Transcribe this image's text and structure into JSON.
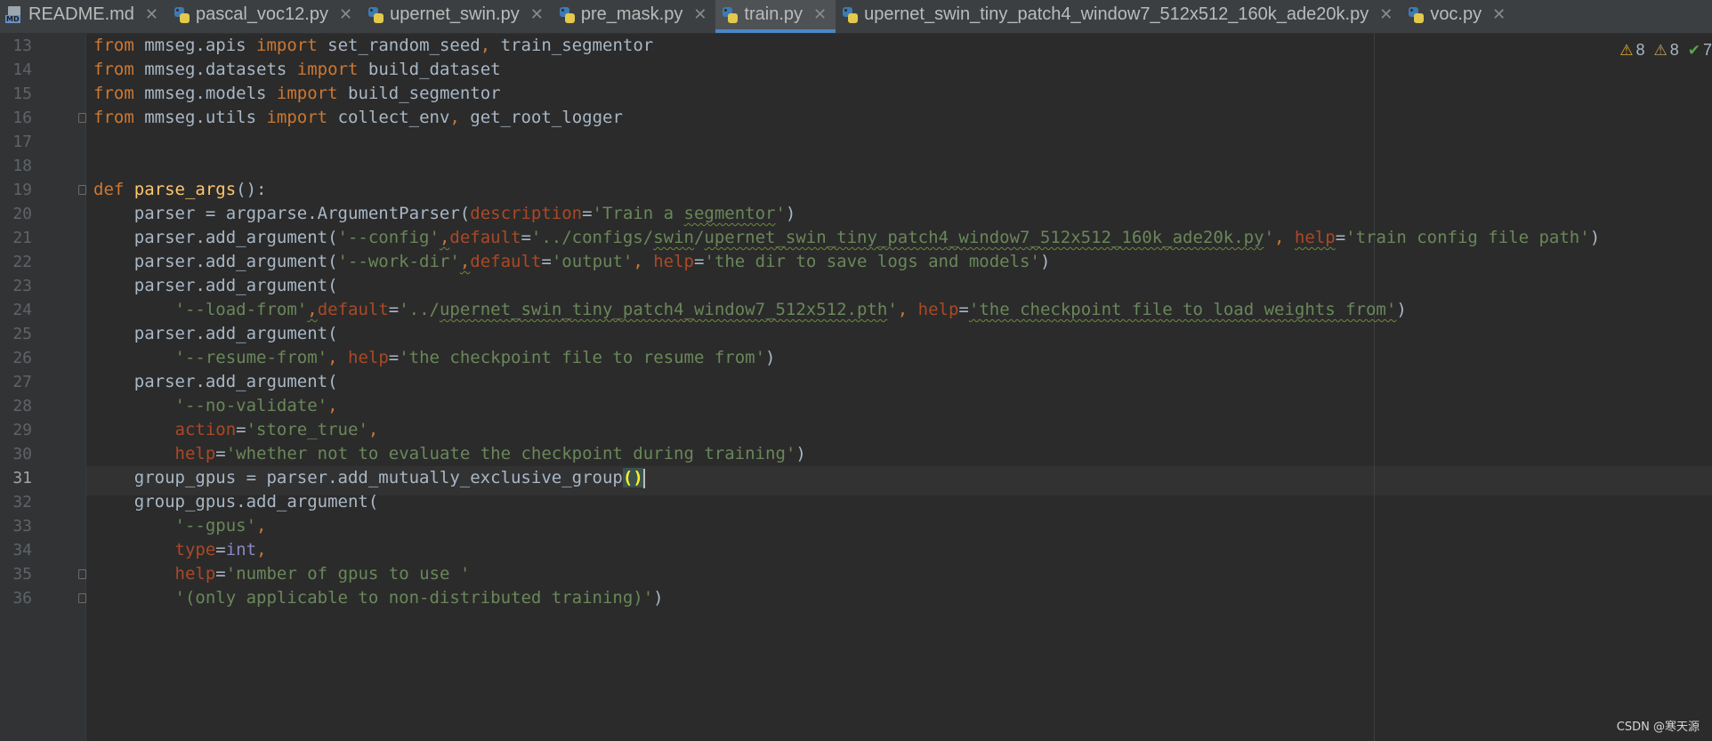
{
  "tabs": [
    {
      "label": "README.md",
      "icon": "markdown-file-icon",
      "icon_text": "MD",
      "active": false
    },
    {
      "label": "pascal_voc12.py",
      "icon": "python-file-icon",
      "active": false
    },
    {
      "label": "upernet_swin.py",
      "icon": "python-file-icon",
      "active": false
    },
    {
      "label": "pre_mask.py",
      "icon": "python-file-icon",
      "active": false
    },
    {
      "label": "train.py",
      "icon": "python-file-icon",
      "active": true
    },
    {
      "label": "upernet_swin_tiny_patch4_window7_512x512_160k_ade20k.py",
      "icon": "python-file-icon",
      "active": false
    },
    {
      "label": "voc.py",
      "icon": "python-file-icon",
      "active": false
    }
  ],
  "tab_close_glyph": "✕",
  "inspections": {
    "warnings": "8",
    "weak_warnings": "8",
    "passed": "7"
  },
  "editor": {
    "active_line": "31",
    "lines": [
      {
        "n": "13",
        "tokens": [
          {
            "t": "from",
            "c": "kw"
          },
          {
            "t": " mmseg.apis "
          },
          {
            "t": "import",
            "c": "kw"
          },
          {
            "t": " set_random_seed"
          },
          {
            "t": ",",
            "c": "kw"
          },
          {
            "t": " train_segmentor"
          }
        ]
      },
      {
        "n": "14",
        "tokens": [
          {
            "t": "from",
            "c": "kw"
          },
          {
            "t": " mmseg.datasets "
          },
          {
            "t": "import",
            "c": "kw"
          },
          {
            "t": " build_dataset"
          }
        ]
      },
      {
        "n": "15",
        "tokens": [
          {
            "t": "from",
            "c": "kw"
          },
          {
            "t": " mmseg.models "
          },
          {
            "t": "import",
            "c": "kw"
          },
          {
            "t": " build_segmentor"
          }
        ]
      },
      {
        "n": "16",
        "fold": true,
        "tokens": [
          {
            "t": "from",
            "c": "kw"
          },
          {
            "t": " mmseg.utils "
          },
          {
            "t": "import",
            "c": "kw"
          },
          {
            "t": " collect_env"
          },
          {
            "t": ",",
            "c": "kw"
          },
          {
            "t": " get_root_logger"
          }
        ]
      },
      {
        "n": "17",
        "tokens": []
      },
      {
        "n": "18",
        "tokens": []
      },
      {
        "n": "19",
        "fold": true,
        "tokens": [
          {
            "t": "def",
            "c": "kw"
          },
          {
            "t": " "
          },
          {
            "t": "parse_args",
            "c": "fn"
          },
          {
            "t": "():"
          }
        ]
      },
      {
        "n": "20",
        "tokens": [
          {
            "t": "    parser = argparse.ArgumentParser("
          },
          {
            "t": "description",
            "c": "par"
          },
          {
            "t": "="
          },
          {
            "t": "'Train a ",
            "c": "str"
          },
          {
            "t": "segmentor",
            "c": "str squig"
          },
          {
            "t": "'",
            "c": "str"
          },
          {
            "t": ")"
          }
        ]
      },
      {
        "n": "21",
        "tokens": [
          {
            "t": "    parser.add_argument("
          },
          {
            "t": "'--config'",
            "c": "str"
          },
          {
            "t": ",",
            "c": "kw squig"
          },
          {
            "t": "default",
            "c": "par"
          },
          {
            "t": "="
          },
          {
            "t": "'../configs/",
            "c": "str"
          },
          {
            "t": "swin",
            "c": "str squig"
          },
          {
            "t": "/",
            "c": "str"
          },
          {
            "t": "upernet_swin_tiny_patch4_window7_512x512_160k_ade20k.py",
            "c": "str squig"
          },
          {
            "t": "'",
            "c": "str"
          },
          {
            "t": ", ",
            "c": "kw"
          },
          {
            "t": "help",
            "c": "par squig"
          },
          {
            "t": "="
          },
          {
            "t": "'train config file path'",
            "c": "str"
          },
          {
            "t": ")"
          }
        ]
      },
      {
        "n": "22",
        "tokens": [
          {
            "t": "    parser.add_argument("
          },
          {
            "t": "'--work-dir'",
            "c": "str"
          },
          {
            "t": ",",
            "c": "kw squig"
          },
          {
            "t": "default",
            "c": "par"
          },
          {
            "t": "="
          },
          {
            "t": "'output'",
            "c": "str"
          },
          {
            "t": ", ",
            "c": "kw"
          },
          {
            "t": "help",
            "c": "par"
          },
          {
            "t": "="
          },
          {
            "t": "'the dir to save logs and models'",
            "c": "str"
          },
          {
            "t": ")"
          }
        ]
      },
      {
        "n": "23",
        "tokens": [
          {
            "t": "    parser.add_argument("
          }
        ]
      },
      {
        "n": "24",
        "tokens": [
          {
            "t": "        "
          },
          {
            "t": "'--load-from'",
            "c": "str"
          },
          {
            "t": ",",
            "c": "kw squig"
          },
          {
            "t": "default",
            "c": "par"
          },
          {
            "t": "="
          },
          {
            "t": "'../",
            "c": "str"
          },
          {
            "t": "upernet_swin_tiny_patch4_window7_512x512.pth",
            "c": "str squig"
          },
          {
            "t": "'",
            "c": "str"
          },
          {
            "t": ", ",
            "c": "kw"
          },
          {
            "t": "help",
            "c": "par"
          },
          {
            "t": "="
          },
          {
            "t": "'the checkpoint file to load weights from'",
            "c": "str squig"
          },
          {
            "t": ")"
          }
        ]
      },
      {
        "n": "25",
        "tokens": [
          {
            "t": "    parser.add_argument("
          }
        ]
      },
      {
        "n": "26",
        "tokens": [
          {
            "t": "        "
          },
          {
            "t": "'--resume-from'",
            "c": "str"
          },
          {
            "t": ", ",
            "c": "kw"
          },
          {
            "t": "help",
            "c": "par"
          },
          {
            "t": "="
          },
          {
            "t": "'the checkpoint file to resume from'",
            "c": "str"
          },
          {
            "t": ")"
          }
        ]
      },
      {
        "n": "27",
        "tokens": [
          {
            "t": "    parser.add_argument("
          }
        ]
      },
      {
        "n": "28",
        "tokens": [
          {
            "t": "        "
          },
          {
            "t": "'--no-validate'",
            "c": "str"
          },
          {
            "t": ",",
            "c": "kw"
          }
        ]
      },
      {
        "n": "29",
        "tokens": [
          {
            "t": "        "
          },
          {
            "t": "action",
            "c": "par"
          },
          {
            "t": "="
          },
          {
            "t": "'store_true'",
            "c": "str"
          },
          {
            "t": ",",
            "c": "kw"
          }
        ]
      },
      {
        "n": "30",
        "tokens": [
          {
            "t": "        "
          },
          {
            "t": "help",
            "c": "par"
          },
          {
            "t": "="
          },
          {
            "t": "'whether not to evaluate the checkpoint during training'",
            "c": "str"
          },
          {
            "t": ")"
          }
        ]
      },
      {
        "n": "31",
        "caret": true,
        "tokens": [
          {
            "t": "    group_gpus = parser.add_mutually_exclusive_group"
          },
          {
            "t": "()",
            "c": "brace"
          }
        ]
      },
      {
        "n": "32",
        "tokens": [
          {
            "t": "    group_gpus.add_argument("
          }
        ]
      },
      {
        "n": "33",
        "tokens": [
          {
            "t": "        "
          },
          {
            "t": "'--gpus'",
            "c": "str"
          },
          {
            "t": ",",
            "c": "kw"
          }
        ]
      },
      {
        "n": "34",
        "tokens": [
          {
            "t": "        "
          },
          {
            "t": "type",
            "c": "par"
          },
          {
            "t": "="
          },
          {
            "t": "int",
            "c": "bi"
          },
          {
            "t": ",",
            "c": "kw"
          }
        ]
      },
      {
        "n": "35",
        "fold": true,
        "tokens": [
          {
            "t": "        "
          },
          {
            "t": "help",
            "c": "par"
          },
          {
            "t": "="
          },
          {
            "t": "'number of gpus to use '",
            "c": "str"
          }
        ]
      },
      {
        "n": "36",
        "fold": true,
        "tokens": [
          {
            "t": "        "
          },
          {
            "t": "'(only applicable to non-distributed training)'",
            "c": "str"
          },
          {
            "t": ")"
          }
        ]
      }
    ]
  },
  "watermark": "CSDN @寒天源"
}
